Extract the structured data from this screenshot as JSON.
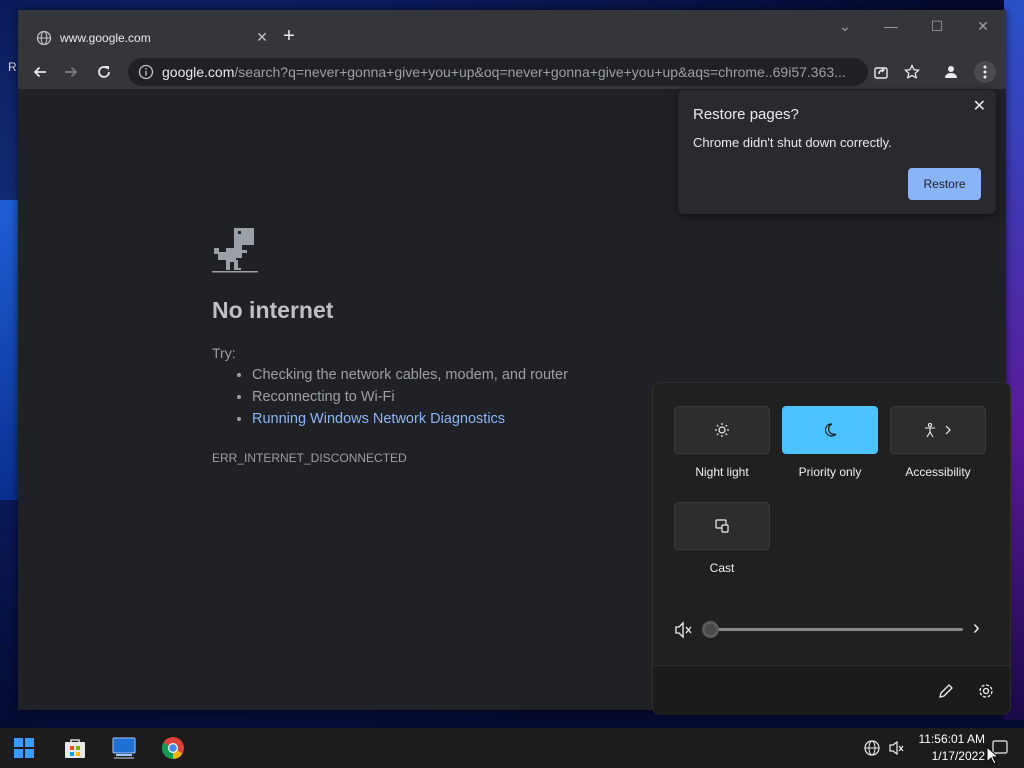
{
  "desktop": {
    "fragment_text": "R"
  },
  "browser": {
    "tab": {
      "title": "www.google.com",
      "close": "✕",
      "icon": "globe-icon"
    },
    "new_tab": "+",
    "window_controls": {
      "dropdown": "⌄",
      "minimize": "—",
      "maximize": "☐",
      "close": "✕"
    },
    "omnibox": {
      "host": "google.com",
      "path": "/search?q=never+gonna+give+you+up&oq=never+gonna+give+you+up&aqs=chrome..69i57.363..."
    }
  },
  "error_page": {
    "title": "No internet",
    "try_label": "Try:",
    "suggestions": [
      "Checking the network cables, modem, and router",
      "Reconnecting to Wi-Fi"
    ],
    "diagnostics_link": "Running Windows Network Diagnostics",
    "error_code": "ERR_INTERNET_DISCONNECTED"
  },
  "restore_popup": {
    "title": "Restore pages?",
    "message": "Chrome didn't shut down correctly.",
    "button": "Restore",
    "close": "✕"
  },
  "quick_settings": {
    "tiles": [
      {
        "label": "Night light",
        "icon": "brightness-icon",
        "active": false
      },
      {
        "label": "Priority only",
        "icon": "moon-icon",
        "active": true
      },
      {
        "label": "Accessibility",
        "icon": "accessibility-icon",
        "active": false
      },
      {
        "label": "Cast",
        "icon": "cast-icon",
        "active": false
      }
    ],
    "volume": {
      "muted": true,
      "level": 0,
      "arrow": "›"
    },
    "colors": {
      "accent": "#4cc2ff"
    }
  },
  "taskbar": {
    "time": "11:56:01 AM",
    "date": "1/17/2022"
  }
}
